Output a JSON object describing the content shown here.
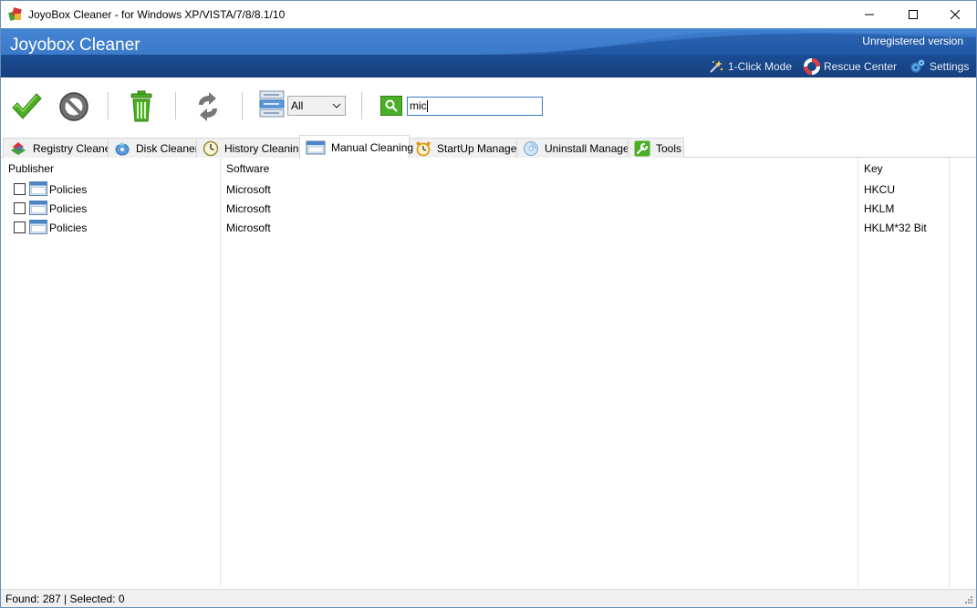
{
  "window": {
    "title": "JoyoBox Cleaner - for Windows XP/VISTA/7/8/8.1/10",
    "minimize_icon": "minimize-icon",
    "maximize_icon": "maximize-icon",
    "close_icon": "close-icon"
  },
  "header": {
    "app_name": "Joyobox Cleaner",
    "license_status": "Unregistered version",
    "menu": [
      {
        "label": "1-Click Mode",
        "icon": "magic-wand-icon"
      },
      {
        "label": "Rescue Center",
        "icon": "lifebuoy-icon"
      },
      {
        "label": "Settings",
        "icon": "gears-icon"
      }
    ]
  },
  "toolbar": {
    "buttons": [
      {
        "icon": "checkmark-icon"
      },
      {
        "icon": "stop-icon"
      },
      {
        "icon": "trash-icon"
      },
      {
        "icon": "refresh-icon"
      }
    ],
    "filter": {
      "value": "All",
      "icon": "item-list-icon"
    },
    "search": {
      "value": "mic",
      "icon": "search-icon"
    }
  },
  "tabs": [
    {
      "label": "Registry Cleaner",
      "icon": "registry-icon",
      "active": false
    },
    {
      "label": "Disk Cleaner",
      "icon": "disk-icon",
      "active": false
    },
    {
      "label": "History Cleaning",
      "icon": "clock-icon",
      "active": false
    },
    {
      "label": "Manual Cleaning",
      "icon": "window-icon",
      "active": true
    },
    {
      "label": "StartUp Manager",
      "icon": "alarm-clock-icon",
      "active": false
    },
    {
      "label": "Uninstall Manager",
      "icon": "cd-icon",
      "active": false
    },
    {
      "label": "Tools",
      "icon": "wrench-icon",
      "active": false
    }
  ],
  "table": {
    "columns": [
      "Publisher",
      "Software",
      "Key"
    ],
    "rows": [
      {
        "publisher": "Policies",
        "software": "Microsoft",
        "key": "HKCU",
        "checked": false
      },
      {
        "publisher": "Policies",
        "software": "Microsoft",
        "key": "HKLM",
        "checked": false
      },
      {
        "publisher": "Policies",
        "software": "Microsoft",
        "key": "HKLM*32 Bit",
        "checked": false
      }
    ]
  },
  "status": {
    "text": "Found: 287 | Selected: 0"
  },
  "colors": {
    "header_blue": "#2d6bbf",
    "header_dark": "#173f7c",
    "accent_green": "#4caf2a",
    "search_border": "#3b7bc8"
  }
}
